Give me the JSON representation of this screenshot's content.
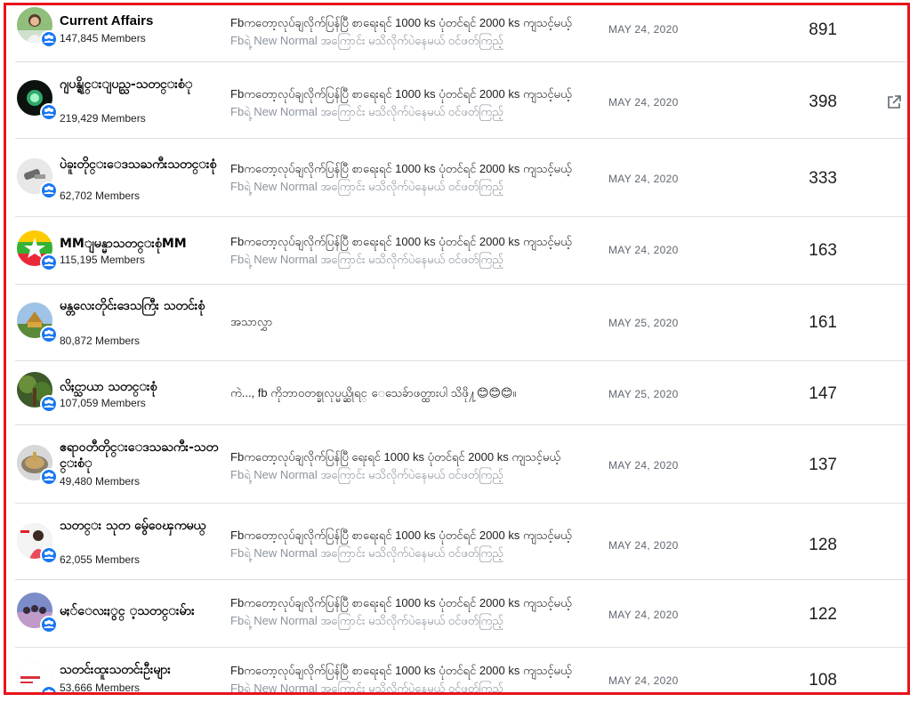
{
  "rows": [
    {
      "name": "Current Affairs",
      "latin": true,
      "members": "147,845 Members",
      "post_line1": "Fbကတော့လုပ်ချလိုက်ပြန်ပြီ စာရေးရင် 1000 ks ပုံတင်ရင် 2000 ks ကျသင့်မယ့်",
      "post_line2": "Fbရဲ့ New Normal အကြောင်း မသိလိုက်ပဲနေမယ် ဝင်ဖတ်ကြည့်",
      "date": "MAY 24, 2020",
      "count": "891",
      "avatar": "person-woman"
    },
    {
      "name": "ဂျပန္ရိုင္းျပည္သ-သတင္းစံု",
      "latin": false,
      "members": "219,429 Members",
      "post_line1": "Fbကတော့လုပ်ချလိုက်ပြန်ပြီ စာရေးရင် 1000 ks ပုံတင်ရင် 2000 ks ကျသင့်မယ့်",
      "post_line2": "Fbရဲ့ New Normal အကြောင်း မသိလိုက်ပဲနေမယ် ဝင်ဖတ်ကြည့်",
      "date": "MAY 24, 2020",
      "count": "398",
      "avatar": "green-glow",
      "external": true
    },
    {
      "name": "ပဲခူးတိုင္းေဒသႀကီးသတင္းစုံ",
      "latin": false,
      "members": "62,702 Members",
      "post_line1": "Fbကတော့လုပ်ချလိုက်ပြန်ပြီ စာရေးရင် 1000 ks ပုံတင်ရင် 2000 ks ကျသင့်မယ့်",
      "post_line2": "Fbရဲ့ New Normal အကြောင်း မသိလိုက်ပဲနေမယ် ဝင်ဖတ်ကြည့်",
      "date": "MAY 24, 2020",
      "count": "333",
      "avatar": "grey-object"
    },
    {
      "name": "MMျမန္မာသတင္းစုံMM",
      "latin": false,
      "members": "115,195 Members",
      "post_line1": "Fbကတော့လုပ်ချလိုက်ပြန်ပြီ စာရေးရင် 1000 ks ပုံတင်ရင် 2000 ks ကျသင့်မယ့်",
      "post_line2": "Fbရဲ့ New Normal အကြောင်း မသိလိုက်ပဲနေမယ် ဝင်ဖတ်ကြည့်",
      "date": "MAY 24, 2020",
      "count": "163",
      "avatar": "myanmar-flag"
    },
    {
      "name": "မန္တလေးတိုင်းဒေသကြီး သတင်းစုံ",
      "latin": false,
      "members": "80,872 Members",
      "post_line1": "အသာလွှာ",
      "post_line2": "",
      "date": "MAY 25, 2020",
      "count": "161",
      "avatar": "palace"
    },
    {
      "name": "လိႈင္သာယာ သတင္းစုံ",
      "latin": false,
      "members": "107,059 Members",
      "post_line1": "ကဲ..., fb ကိုဘာဝတစ္ခုလုပ္မယ္ဆိုရင္ ေသေခ်ာဖတ္ထားပါ သိဖို႔😊😊😊။",
      "post_line2": "",
      "date": "MAY 25, 2020",
      "count": "147",
      "avatar": "forest"
    },
    {
      "name": "ဧရာဝတီတိုင္းေဒသႀကီး-သတင္းစံု",
      "latin": false,
      "members": "49,480 Members",
      "post_line1": "Fbကတော့လုပ်ချလိုက်ပြန်ပြီ ရေးရင် 1000 ks ပုံတင်ရင် 2000 ks ကျသင့်မယ့်",
      "post_line2": "Fbရဲ့ New Normal အကြောင်း မသိလိုက်ပဲနေမယ် ဝင်ဖတ်ကြည့်",
      "date": "MAY 24, 2020",
      "count": "137",
      "avatar": "pagoda-disc"
    },
    {
      "name": "သတင္း သုတ မ်ွေဝေၾကမယ္",
      "latin": false,
      "members": "62,055 Members",
      "post_line1": "Fbကတော့လုပ်ချလိုက်ပြန်ပြီ စာရေးရင် 1000 ks ပုံတင်ရင် 2000 ks ကျသင့်မယ့်",
      "post_line2": "Fbရဲ့ New Normal အကြောင်း မသိလိုက်ပဲနေမယ် ဝင်ဖတ်ကြည့်",
      "date": "MAY 24, 2020",
      "count": "128",
      "avatar": "person-poster"
    },
    {
      "name": "မႏၲေလးႏွင္ ့သတင္းမ်ား",
      "latin": false,
      "members": "",
      "post_line1": "Fbကတော့လုပ်ချလိုက်ပြန်ပြီ စာရေးရင် 1000 ks ပုံတင်ရင် 2000 ks ကျသင့်မယ့်",
      "post_line2": "Fbရဲ့ New Normal အကြောင်း မသိလိုက်ပဲနေမယ် ဝင်ဖတ်ကြည့်",
      "date": "MAY 24, 2020",
      "count": "122",
      "avatar": "group-people"
    },
    {
      "name": "သတင်းထူးသတင်းဦးများ",
      "latin": false,
      "members": "53,666 Members",
      "post_line1": "Fbကတော့လုပ်ချလိုက်ပြန်ပြီ စာရေးရင် 1000 ks ပုံတင်ရင် 2000 ks ကျသင့်မယ့်",
      "post_line2": "Fbရဲ့ New Normal အကြောင်း မသိလိုက်ပဲနေမယ် ဝင်ဖတ်ကြည့်",
      "date": "MAY 24, 2020",
      "count": "108",
      "avatar": "news-logo"
    }
  ],
  "icons": {
    "group_badge": "group-badge-icon",
    "external_link": "external-link-icon"
  },
  "colors": {
    "frame": "#e8131b",
    "badge": "#1877f2",
    "muted_text": "#8d949e"
  }
}
